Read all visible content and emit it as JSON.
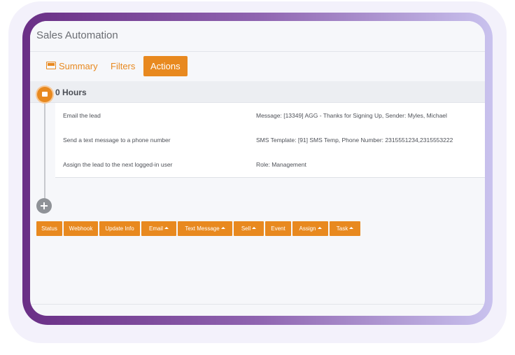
{
  "app": {
    "title": "Sales Automation"
  },
  "tabs": [
    {
      "label": "Summary",
      "icon": "summary-icon",
      "active": false
    },
    {
      "label": "Filters",
      "active": false
    },
    {
      "label": "Actions",
      "active": true
    }
  ],
  "step": {
    "title": "0 Hours",
    "icon": "note-icon"
  },
  "actions": [
    {
      "name": "Email the lead",
      "detail": "Message: [13349] AGG - Thanks for Signing Up, Sender: Myles, Michael"
    },
    {
      "name": "Send a text message to a phone number",
      "detail": "SMS Template: [91] SMS Temp, Phone Number: 2315551234,2315553222"
    },
    {
      "name": "Assign the lead to the next logged-in user",
      "detail": "Role: Management"
    }
  ],
  "add_button": {
    "icon": "plus-icon"
  },
  "action_buttons": [
    {
      "label": "Status",
      "dropdown": false
    },
    {
      "label": "Webhook",
      "dropdown": false
    },
    {
      "label": "Update Info",
      "dropdown": false
    },
    {
      "label": "Email",
      "dropdown": true
    },
    {
      "label": "Text Message",
      "dropdown": true
    },
    {
      "label": "Sell",
      "dropdown": true
    },
    {
      "label": "Event",
      "dropdown": false
    },
    {
      "label": "Assign",
      "dropdown": true
    },
    {
      "label": "Task",
      "dropdown": true
    }
  ],
  "colors": {
    "accent": "#e8891f",
    "frame_start": "#6a2f86",
    "frame_end": "#c9c2ee",
    "text": "#4d5057"
  }
}
